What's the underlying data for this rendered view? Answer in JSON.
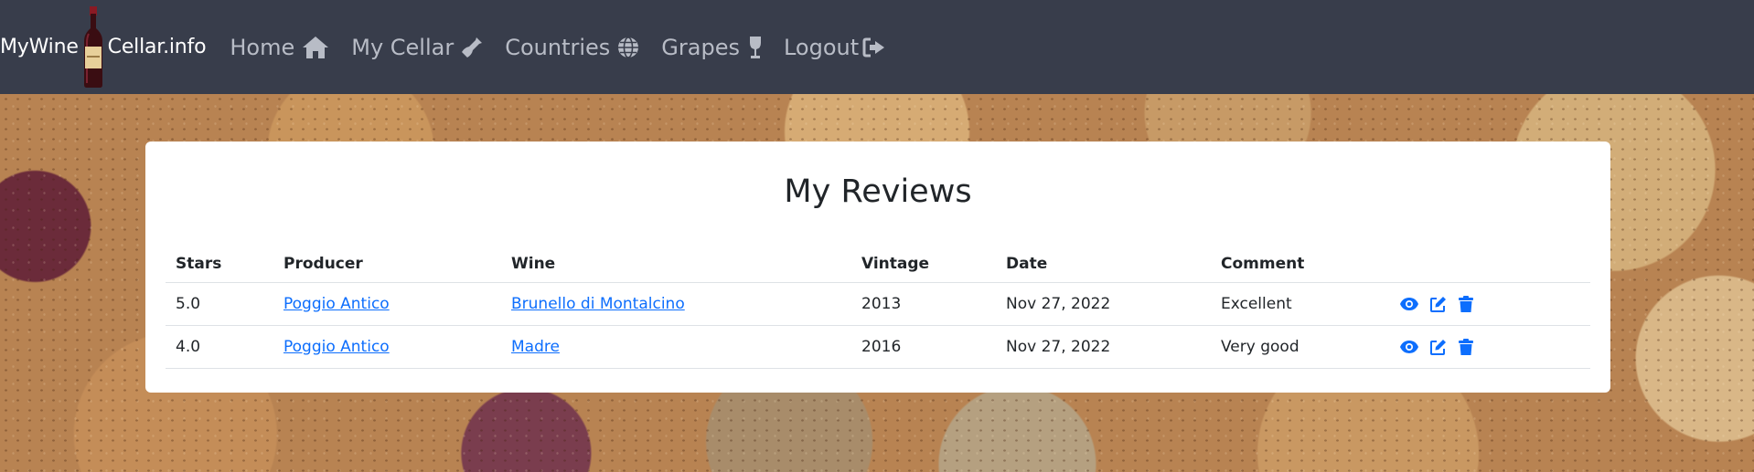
{
  "brand": {
    "left_text": "MyWine",
    "right_text": "Cellar.info"
  },
  "nav": {
    "home": "Home",
    "my_cellar": "My Cellar",
    "countries": "Countries",
    "grapes": "Grapes",
    "logout": "Logout"
  },
  "icons": {
    "home": "home-icon",
    "my_cellar": "bottle-icon",
    "countries": "globe-icon",
    "grapes": "wine-glass-icon",
    "logout": "logout-icon",
    "view": "eye-icon",
    "edit": "edit-icon",
    "delete": "trash-icon"
  },
  "colors": {
    "navbar": "#383d4b",
    "nav_text": "#b8bcc6",
    "link": "#0d6efd",
    "card": "#ffffff"
  },
  "page": {
    "title": "My Reviews"
  },
  "table": {
    "headers": {
      "stars": "Stars",
      "producer": "Producer",
      "wine": "Wine",
      "vintage": "Vintage",
      "date": "Date",
      "comment": "Comment"
    },
    "rows": [
      {
        "stars": "5.0",
        "producer": "Poggio Antico",
        "wine": "Brunello di Montalcino",
        "vintage": "2013",
        "date": "Nov 27, 2022",
        "comment": "Excellent"
      },
      {
        "stars": "4.0",
        "producer": "Poggio Antico",
        "wine": "Madre",
        "vintage": "2016",
        "date": "Nov 27, 2022",
        "comment": "Very good"
      }
    ]
  }
}
